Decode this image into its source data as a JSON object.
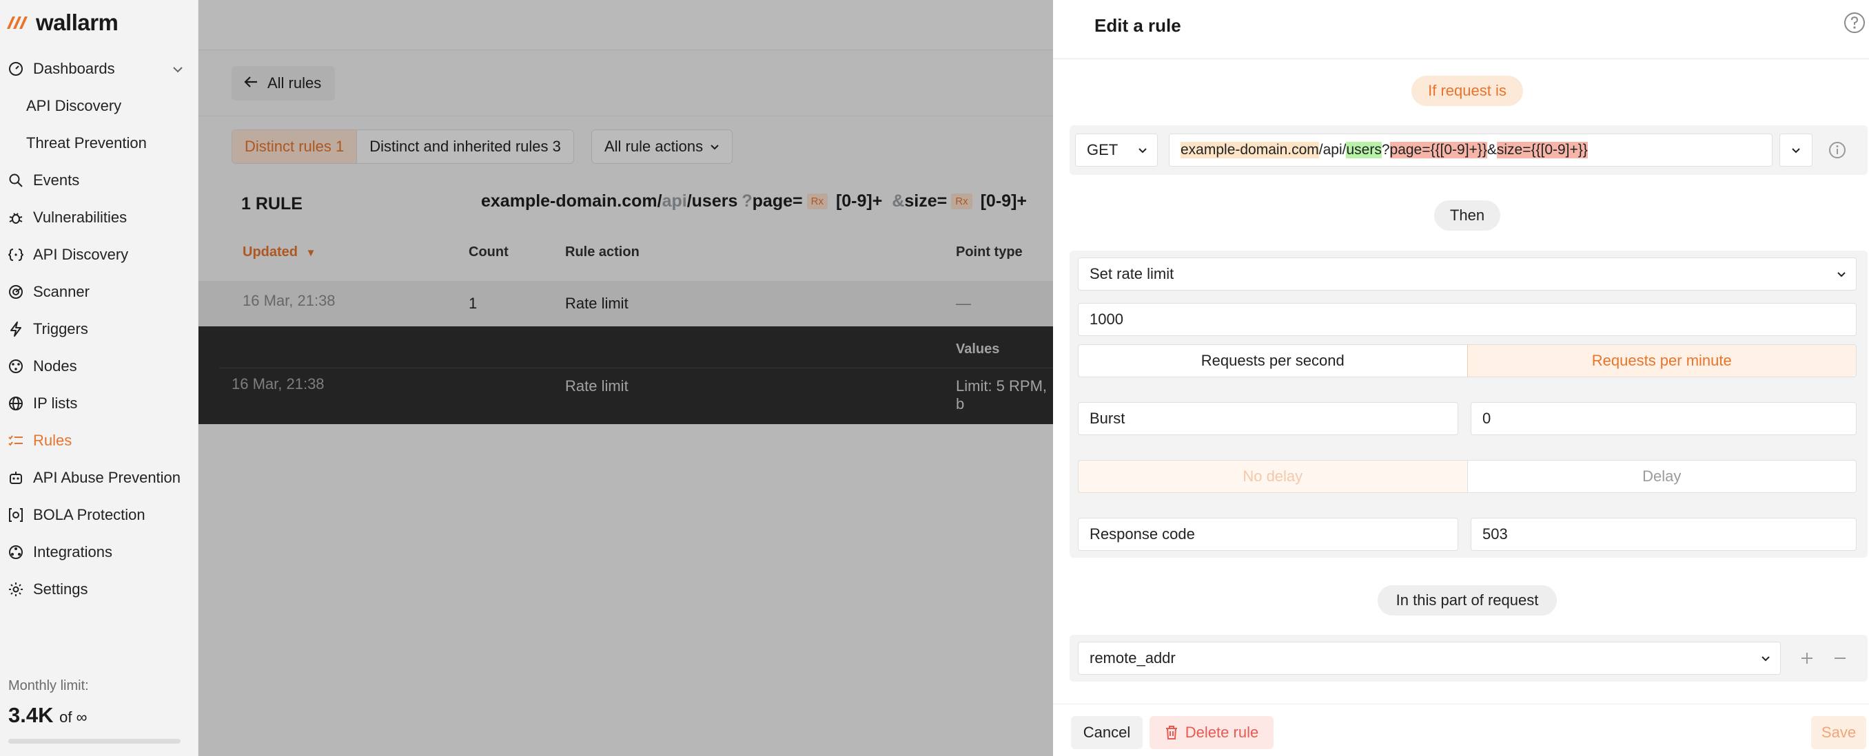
{
  "brand": {
    "name": "wallarm",
    "accent": "#e8742c"
  },
  "sidebar": {
    "items": [
      {
        "label": "Dashboards",
        "icon": "dashboard-icon",
        "expandable": true
      },
      {
        "label": "API Discovery",
        "sub": true
      },
      {
        "label": "Threat Prevention",
        "sub": true
      },
      {
        "label": "Events",
        "icon": "search-icon"
      },
      {
        "label": "Vulnerabilities",
        "icon": "bug-icon"
      },
      {
        "label": "API Discovery",
        "icon": "braces-icon"
      },
      {
        "label": "Scanner",
        "icon": "radar-icon"
      },
      {
        "label": "Triggers",
        "icon": "bolt-icon"
      },
      {
        "label": "Nodes",
        "icon": "nodes-icon"
      },
      {
        "label": "IP lists",
        "icon": "globe-icon"
      },
      {
        "label": "Rules",
        "icon": "rules-icon",
        "active": true
      },
      {
        "label": "API Abuse Prevention",
        "icon": "robot-icon"
      },
      {
        "label": "BOLA Protection",
        "icon": "bola-icon"
      },
      {
        "label": "Integrations",
        "icon": "integrations-icon"
      },
      {
        "label": "Settings",
        "icon": "gear-icon"
      }
    ],
    "monthly_limit_label": "Monthly limit:",
    "monthly_value": "3.4K",
    "monthly_of": "of ∞"
  },
  "main": {
    "back_label": "All rules",
    "tabs": [
      {
        "label": "Distinct rules 1",
        "active": true
      },
      {
        "label": "Distinct and inherited rules 3"
      }
    ],
    "all_actions_label": "All rule actions",
    "rule_count": "1 RULE",
    "path": {
      "host": "example-domain.com/",
      "api": "api",
      "users": "/users",
      "q": "?",
      "page": "page=",
      "rx": "Rx",
      "regex1": "[0-9]+",
      "amp": "&",
      "size": "size=",
      "regex2": "[0-9]+"
    },
    "columns": {
      "updated": "Updated",
      "count": "Count",
      "rule_action": "Rule action",
      "point_type": "Point type",
      "values": "Values"
    },
    "row": {
      "updated": "16 Mar, 21:38",
      "count": "1",
      "rule_action": "Rate limit",
      "point_type": "—"
    },
    "detail_row": {
      "updated": "16 Mar, 21:38",
      "rule_action": "Rate limit",
      "values": "Limit: 5 RPM, b"
    }
  },
  "drawer": {
    "title": "Edit a rule",
    "if_request_is": "If request is",
    "method": "GET",
    "url": {
      "host": "example-domain.com",
      "slash1": "/api/",
      "users": "users",
      "q": "?",
      "page": "page={{[0-9]+}}",
      "amp": "&",
      "size": "size={{[0-9]+}}"
    },
    "then": "Then",
    "action": "Set rate limit",
    "rate_value": "1000",
    "rate_unit_options": [
      "Requests per second",
      "Requests per minute"
    ],
    "rate_unit_selected": "Requests per minute",
    "burst_label": "Burst",
    "burst_value": "0",
    "delay_options": [
      "No delay",
      "Delay"
    ],
    "response_code_label": "Response code",
    "response_code_value": "503",
    "in_this_part": "In this part of request",
    "point": "remote_addr",
    "cancel": "Cancel",
    "delete": "Delete rule",
    "save": "Save"
  }
}
